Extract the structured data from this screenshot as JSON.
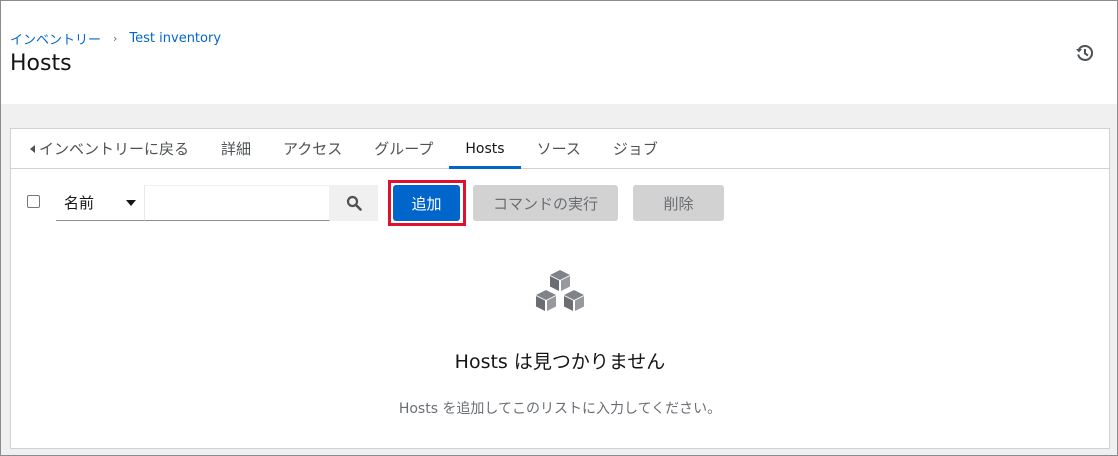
{
  "breadcrumb": {
    "parent": "インベントリー",
    "separator": "›",
    "current": "Test inventory"
  },
  "header": {
    "title": "Hosts",
    "history_icon": "history-icon"
  },
  "tabs": [
    {
      "label": "インベントリーに戻る",
      "back": true
    },
    {
      "label": "詳細"
    },
    {
      "label": "アクセス"
    },
    {
      "label": "グループ"
    },
    {
      "label": "Hosts",
      "active": true
    },
    {
      "label": "ソース"
    },
    {
      "label": "ジョブ"
    }
  ],
  "toolbar": {
    "filter_select": "名前",
    "search_value": "",
    "search_icon": "search-icon",
    "add_label": "追加",
    "run_command_label": "コマンドの実行",
    "delete_label": "削除"
  },
  "empty_state": {
    "icon": "cubes-icon",
    "title": "Hosts は見つかりません",
    "body": "Hosts を追加してこのリストに入力してください。"
  },
  "colors": {
    "primary": "#0066cc",
    "highlight": "#e0102f",
    "disabled": "#d2d2d2"
  }
}
